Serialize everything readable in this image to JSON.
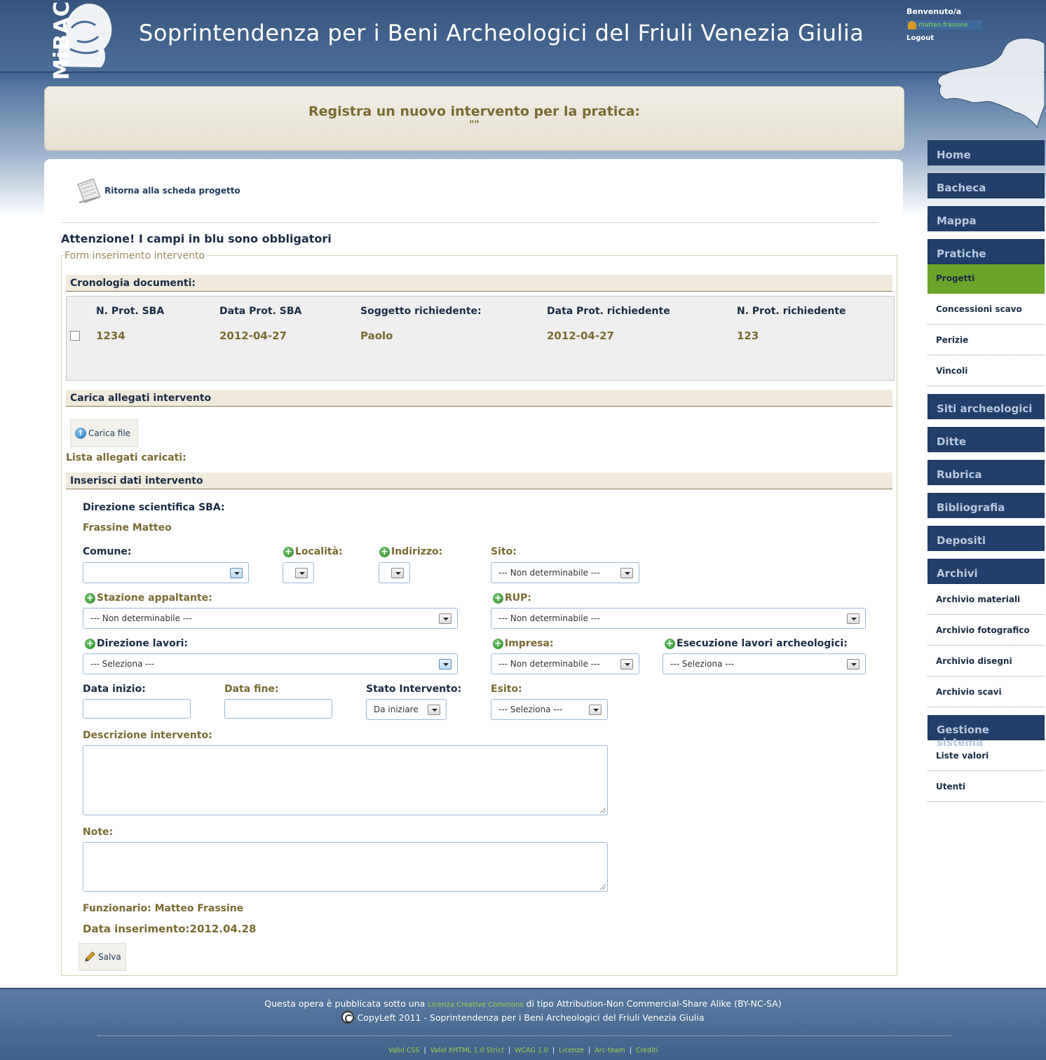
{
  "header": {
    "logo_text": "MiBAC",
    "site_title": "Soprintendenza per i Beni Archeologici del Friuli Venezia Giulia",
    "welcome": "Benvenuto/a",
    "username": "matteo.frassine",
    "logout": "Logout"
  },
  "title_panel": {
    "title": "Registra un nuovo intervento per la pratica:",
    "subtitle": "\"\""
  },
  "back_link": "Ritorna alla scheda progetto",
  "attention": "Attenzione! I campi in blu sono obbligatori",
  "form_legend": "Form inserimento intervento",
  "cronologia": {
    "title": "Cronologia documenti:",
    "headers": [
      "N. Prot. SBA",
      "Data Prot. SBA",
      "Soggetto richiedente:",
      "Data Prot. richiedente",
      "N. Prot. richiedente"
    ],
    "rows": [
      [
        "1234",
        "2012-04-27",
        "Paolo",
        "2012-04-27",
        "123"
      ]
    ]
  },
  "allegati": {
    "title": "Carica allegati intervento",
    "upload_button": "Carica file",
    "list_label": "Lista allegati caricati:"
  },
  "intervento": {
    "title": "Inserisci dati intervento",
    "direzione_label": "Direzione scientifica SBA:",
    "direzione_value": "Frassine Matteo",
    "comune_label": "Comune:",
    "comune_value": "",
    "localita_label": "Località:",
    "indirizzo_label": "Indirizzo:",
    "sito_label": "Sito:",
    "sito_value": "--- Non determinabile ---",
    "stazione_label": "Stazione appaltante:",
    "stazione_value": "--- Non determinabile ---",
    "rup_label": "RUP:",
    "rup_value": "--- Non determinabile ---",
    "direzione_lavori_label": "Direzione lavori:",
    "direzione_lavori_value": "--- Seleziona ---",
    "impresa_label": "Impresa:",
    "impresa_value": "--- Non determinabile ---",
    "esecuzione_label": "Esecuzione lavori archeologici:",
    "esecuzione_value": "--- Seleziona ---",
    "data_inizio_label": "Data inizio:",
    "data_fine_label": "Data fine:",
    "stato_label": "Stato Intervento:",
    "stato_value": "Da iniziare",
    "esito_label": "Esito:",
    "esito_value": "--- Seleziona ---",
    "descrizione_label": "Descrizione intervento:",
    "note_label": "Note:",
    "funzionario": "Funzionario: Matteo Frassine",
    "data_inserimento": "Data inserimento:2012.04.28",
    "save_button": "Salva"
  },
  "sidebar": {
    "home": "Home",
    "bacheca": "Bacheca",
    "mappa": "Mappa",
    "pratiche": "Pratiche",
    "pratiche_sub": [
      "Progetti",
      "Concessioni scavo",
      "Perizie",
      "Vincoli"
    ],
    "siti": "Siti archeologici",
    "ditte": "Ditte",
    "rubrica": "Rubrica",
    "bibliografia": "Bibliografia",
    "depositi": "Depositi",
    "archivi": "Archivi",
    "archivi_sub": [
      "Archivio materiali",
      "Archivio fotografico",
      "Archivio disegni",
      "Archivio scavi"
    ],
    "gestione": "Gestione sistema",
    "gestione_sub": [
      "Liste valori",
      "Utenti"
    ]
  },
  "footer": {
    "line1_pre": "Questa opera è pubblicata sotto una",
    "line1_link": "Licenza Creative Commons",
    "line1_post": "di tipo Attribution-Non Commercial-Share Alike (BY-NC-SA)",
    "line2": "CopyLeft 2011 - Soprintendenza per i Beni Archeologici del Friuli Venezia Giulia",
    "links": [
      "Valid CSS",
      "Valid XHTML 1.0 Strict",
      "WCAG 1.0",
      "Licenze",
      "Arc-team",
      "Crediti"
    ]
  },
  "colors": {
    "header_blue": "#35557e",
    "nav_blue": "#223f6a",
    "active_green": "#6aa52a",
    "olive_text": "#7a6a30",
    "navy_text": "#1a2c45"
  }
}
